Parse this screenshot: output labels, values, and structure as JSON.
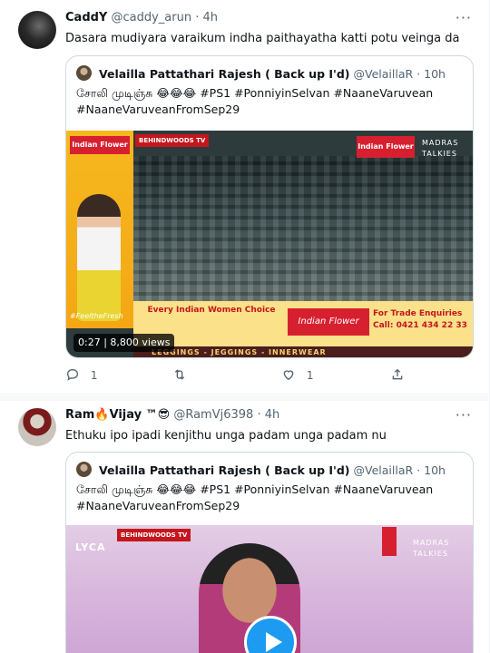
{
  "tweets": [
    {
      "name": "CaddY",
      "handle": "@caddy_arun",
      "time": "4h",
      "text": "Dasara mudiyara varaikum indha paithayatha katti potu veinga da",
      "quote": {
        "name": "Velailla Pattathari Rajesh ( Back up I'd)",
        "handle": "@VelaillaR",
        "time": "10h",
        "text_line1": "சோலி முடிஞ்சு 😂😂😂 #PS1 #PonniyinSelvan #NaaneVaruvean",
        "text_line2": "#NaaneVaruveanFromSep29",
        "media": {
          "video_duration": "0:27",
          "views": "8,800 views",
          "overlay_behindwoods": "BEHINDWOODS TV",
          "overlay_brand": "Indian Flower",
          "overlay_madras": "MADRAS TALKIES",
          "banner_left": "Every Indian Women Choice",
          "banner_right": "For Trade Enquiries Call: 0421 434 22 33",
          "banner_strip": "LEGGINGS - JEGGINGS - INNERWEAR",
          "ad_tagline": "#FeeltheFresh"
        }
      },
      "actions": {
        "reply_count": "1",
        "retweet_count": "",
        "like_count": "1"
      }
    },
    {
      "name": "Ram🔥Vijay ™😎",
      "handle": "@RamVj6398",
      "time": "4h",
      "text": "Ethuku ipo ipadi kenjithu unga padam unga padam nu",
      "quote": {
        "name": "Velailla Pattathari Rajesh ( Back up I'd)",
        "handle": "@VelaillaR",
        "time": "10h",
        "text_line1": "சோலி முடிஞ்சு 😂😂😂 #PS1 #PonniyinSelvan #NaaneVaruvean",
        "text_line2": "#NaaneVaruveanFromSep29",
        "media": {
          "overlay_lyca": "LYCA",
          "overlay_behindwoods": "BEHINDWOODS TV",
          "overlay_madras": "MADRAS TALKIES"
        }
      }
    }
  ],
  "ui": {
    "separator": "·",
    "more_glyph": "···"
  },
  "icons": {
    "reply": "reply-icon",
    "retweet": "retweet-icon",
    "like": "like-icon",
    "share": "share-icon",
    "play": "play-icon"
  },
  "colors": {
    "accent": "#1d9bf0",
    "muted": "#536471",
    "border": "#cfd9de"
  }
}
